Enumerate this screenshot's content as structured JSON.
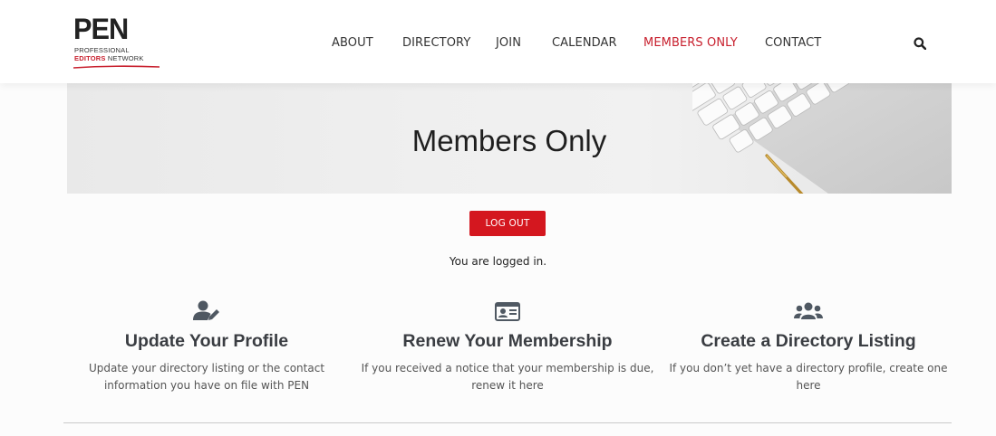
{
  "logo": {
    "name": "PEN",
    "line1": "PROFESSIONAL",
    "line2_accent": "EDITORS",
    "line2_rest": " NETWORK",
    "accent_color": "#c8202e"
  },
  "nav": {
    "items": [
      {
        "label": "ABOUT",
        "active": false
      },
      {
        "label": "DIRECTORY",
        "active": false
      },
      {
        "label": "JOIN",
        "active": false
      },
      {
        "label": "CALENDAR",
        "active": false
      },
      {
        "label": "MEMBERS ONLY",
        "active": true
      },
      {
        "label": "CONTACT",
        "active": false
      }
    ],
    "search_icon": "search-icon",
    "active_color": "#c8202e"
  },
  "hero": {
    "title": "Members Only"
  },
  "logout": {
    "label": "LOG OUT",
    "color": "#d4171f"
  },
  "status": "You are logged in.",
  "features": [
    {
      "icon": "user-edit-icon",
      "title": "Update Your Profile",
      "text": "Update your directory listing or the contact information you have on file with PEN"
    },
    {
      "icon": "id-card-icon",
      "title": "Renew Your Membership",
      "text": "If you received a notice that your membership is due, renew it here"
    },
    {
      "icon": "users-icon",
      "title": "Create a Directory Listing",
      "text": "If you don’t yet have a directory profile, create one here"
    }
  ]
}
